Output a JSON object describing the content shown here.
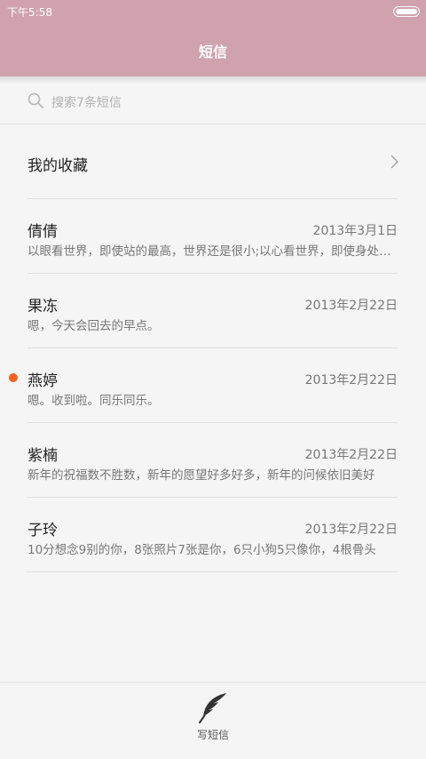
{
  "status_bar": {
    "time": "下午5:58"
  },
  "header": {
    "title": "短信",
    "color": "#cfa2ae"
  },
  "search": {
    "placeholder": "搜索7条短信",
    "icon": "search-icon"
  },
  "favorites": {
    "label": "我的收藏",
    "icon": "chevron-right-icon"
  },
  "messages": [
    {
      "name": "倩倩",
      "date": "2013年3月1日",
      "preview": "以眼看世界，即使站的最高，世界还是很小;以心看世界，即使身处斗室，世界也很大",
      "unread": false
    },
    {
      "name": "果冻",
      "date": "2013年2月22日",
      "preview": "嗯，今天会回去的早点。",
      "unread": false
    },
    {
      "name": "燕婷",
      "date": "2013年2月22日",
      "preview": "嗯。收到啦。同乐同乐。",
      "unread": true
    },
    {
      "name": "紫楠",
      "date": "2013年2月22日",
      "preview": "新年的祝福数不胜数，新年的愿望好多好多，新年的问候依旧美好",
      "unread": false
    },
    {
      "name": "子玲",
      "date": "2013年2月22日",
      "preview": "10分想念9别的你，8张照片7张是你，6只小狗5只像你，4根骨头",
      "unread": false
    }
  ],
  "bottom_bar": {
    "compose_label": "写短信",
    "icon": "feather-icon"
  },
  "colors": {
    "unread_dot": "#f26322",
    "background": "#f5f5f5"
  }
}
